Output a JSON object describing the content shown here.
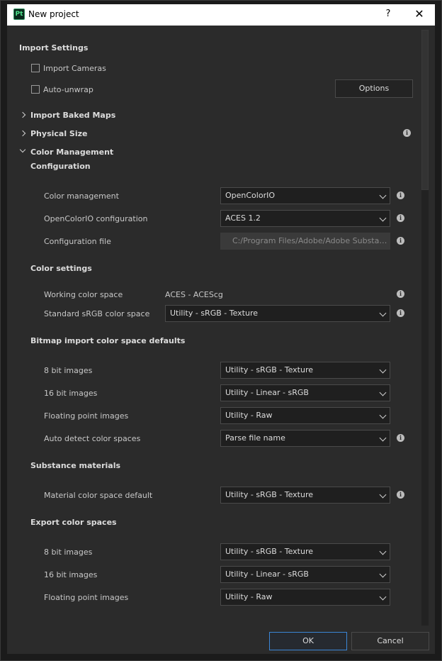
{
  "window": {
    "title": "New project",
    "app_icon_text": "Pt",
    "help_label": "?",
    "close_label": "✕"
  },
  "import_settings": {
    "title": "Import Settings",
    "import_cameras": {
      "label": "Import Cameras",
      "checked": false
    },
    "auto_unwrap": {
      "label": "Auto-unwrap",
      "checked": false
    },
    "options_label": "Options"
  },
  "sections": {
    "import_baked_maps": "Import Baked Maps",
    "physical_size": "Physical Size",
    "color_management": "Color Management"
  },
  "configuration": {
    "title": "Configuration",
    "color_management": {
      "label": "Color management",
      "value": "OpenColorIO"
    },
    "ocio_config": {
      "label": "OpenColorIO configuration",
      "value": "ACES 1.2"
    },
    "config_file": {
      "label": "Configuration file",
      "value": "C:/Program Files/Adobe/Adobe Substanc..."
    }
  },
  "color_settings": {
    "title": "Color settings",
    "working": {
      "label": "Working color space",
      "value": "ACES - ACEScg"
    },
    "standard_srgb": {
      "label": "Standard sRGB color space",
      "value": "Utility - sRGB - Texture"
    }
  },
  "bitmap_import": {
    "title": "Bitmap import color space defaults",
    "bit8": {
      "label": "8 bit images",
      "value": "Utility - sRGB - Texture"
    },
    "bit16": {
      "label": "16 bit images",
      "value": "Utility - Linear - sRGB"
    },
    "float": {
      "label": "Floating point images",
      "value": "Utility - Raw"
    },
    "auto_detect": {
      "label": "Auto detect color spaces",
      "value": "Parse file name"
    }
  },
  "substance": {
    "title": "Substance materials",
    "material_default": {
      "label": "Material color space default",
      "value": "Utility - sRGB - Texture"
    }
  },
  "export": {
    "title": "Export color spaces",
    "bit8": {
      "label": "8 bit images",
      "value": "Utility - sRGB - Texture"
    },
    "bit16": {
      "label": "16 bit images",
      "value": "Utility - Linear - sRGB"
    },
    "float": {
      "label": "Floating point images",
      "value": "Utility - Raw"
    }
  },
  "footer": {
    "ok": "OK",
    "cancel": "Cancel"
  },
  "colors": {
    "accent": "#3b86d6",
    "panel": "#2b2b2b",
    "field": "#1f1f1f"
  }
}
